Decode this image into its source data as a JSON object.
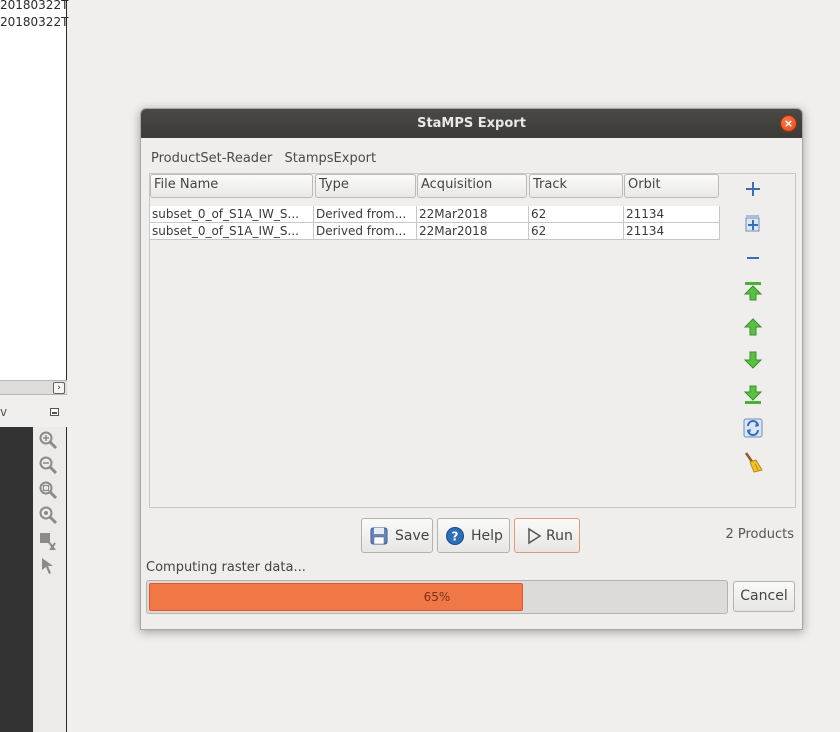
{
  "background": {
    "list_items": [
      "20180322T",
      "20180322T"
    ],
    "panel_header_fragment": "v"
  },
  "dialog": {
    "title": "StaMPS Export",
    "tabs": [
      "ProductSet-Reader",
      "StampsExport"
    ],
    "table": {
      "columns": [
        "File Name",
        "Type",
        "Acquisition",
        "Track",
        "Orbit"
      ],
      "rows": [
        [
          "subset_0_of_S1A_IW_S...",
          "Derived from...",
          "22Mar2018",
          "62",
          "21134"
        ],
        [
          "subset_0_of_S1A_IW_S...",
          "Derived from...",
          "22Mar2018",
          "62",
          "21134"
        ]
      ]
    },
    "products_count": "2 Products",
    "buttons": {
      "save": "Save",
      "help": "Help",
      "run": "Run",
      "cancel": "Cancel"
    },
    "progress": {
      "status": "Computing raster data...",
      "percent_label": "65%",
      "fraction": 0.65,
      "fill_color": "#f07746"
    },
    "side_icons": [
      "add-icon",
      "add-multiple-icon",
      "remove-icon",
      "move-top-icon",
      "move-up-icon",
      "move-down-icon",
      "move-bottom-icon",
      "refresh-icon",
      "clear-icon"
    ]
  }
}
